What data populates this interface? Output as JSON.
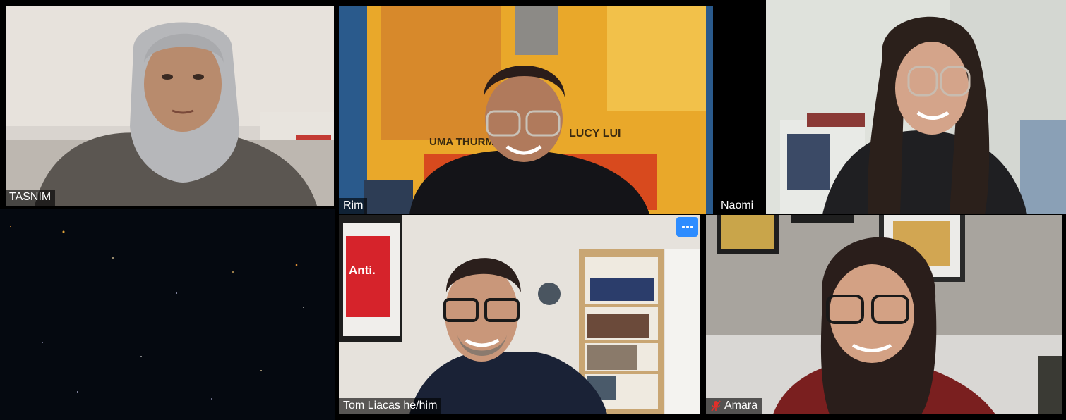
{
  "participants": [
    {
      "id": "tasnim",
      "name": "TASNIM",
      "muted": false
    },
    {
      "id": "rim",
      "name": "Rim",
      "muted": false
    },
    {
      "id": "naomi",
      "name": "Naomi",
      "muted": false
    },
    {
      "id": "tom",
      "name": "Tom Liacas he/him",
      "muted": false,
      "hovered": true
    },
    {
      "id": "amara",
      "name": "Amara",
      "muted": true
    }
  ],
  "rim_poster_text": {
    "left": "UMA THURM",
    "right": "LUCY LUI"
  },
  "tom_sign_text": "Anti.",
  "icons": {
    "more": "more-options-icon",
    "muted": "muted-mic-icon"
  },
  "colors": {
    "accent": "#2d8cff",
    "muted_red": "#e0302a",
    "background": "#000000"
  }
}
